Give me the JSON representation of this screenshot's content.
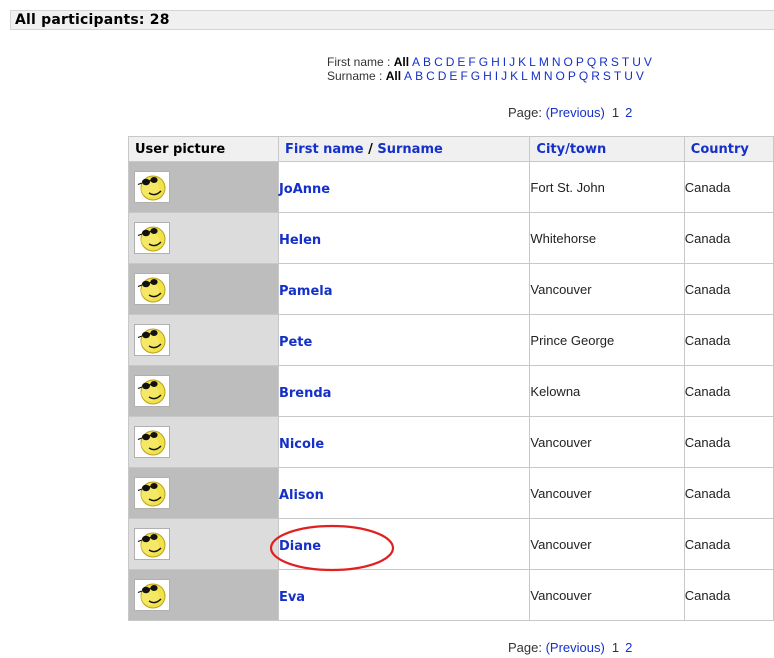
{
  "header": {
    "title": "All participants: 28"
  },
  "initials_bar": {
    "first_name_label": "First name : ",
    "surname_label": "Surname : ",
    "all_label": "All",
    "first_name_letters": [
      "A",
      "B",
      "C",
      "D",
      "E",
      "F",
      "G",
      "H",
      "I",
      "J",
      "K",
      "L",
      "M",
      "N",
      "O",
      "P",
      "Q",
      "R",
      "S",
      "T",
      "U",
      "V"
    ],
    "surname_letters": [
      "A",
      "B",
      "C",
      "D",
      "E",
      "F",
      "G",
      "H",
      "I",
      "J",
      "K",
      "L",
      "M",
      "N",
      "O",
      "P",
      "Q",
      "R",
      "S",
      "T",
      "U",
      "V"
    ]
  },
  "paging": {
    "label": "Page: ",
    "previous": "(Previous)",
    "pages": [
      "1",
      "2"
    ]
  },
  "table": {
    "headers": {
      "user_picture": "User picture",
      "first_name": "First name",
      "name_sep": " / ",
      "surname": "Surname",
      "city": "City/town",
      "country": "Country"
    },
    "rows": [
      {
        "name": "JoAnne",
        "city": "Fort St. John",
        "country": "Canada"
      },
      {
        "name": "Helen",
        "city": "Whitehorse",
        "country": "Canada"
      },
      {
        "name": "Pamela",
        "city": "Vancouver",
        "country": "Canada"
      },
      {
        "name": "Pete",
        "city": "Prince George",
        "country": "Canada"
      },
      {
        "name": "Brenda",
        "city": "Kelowna",
        "country": "Canada"
      },
      {
        "name": "Nicole",
        "city": "Vancouver",
        "country": "Canada"
      },
      {
        "name": "Alison",
        "city": "Vancouver",
        "country": "Canada"
      },
      {
        "name": "Diane",
        "city": "Vancouver",
        "country": "Canada"
      },
      {
        "name": "Eva",
        "city": "Vancouver",
        "country": "Canada"
      }
    ]
  },
  "colors": {
    "link": "#1530c8",
    "highlight": "#e02020",
    "smiley": "#f2e24a"
  },
  "icons": {
    "avatar": "smiley-face-sunglasses-icon"
  }
}
